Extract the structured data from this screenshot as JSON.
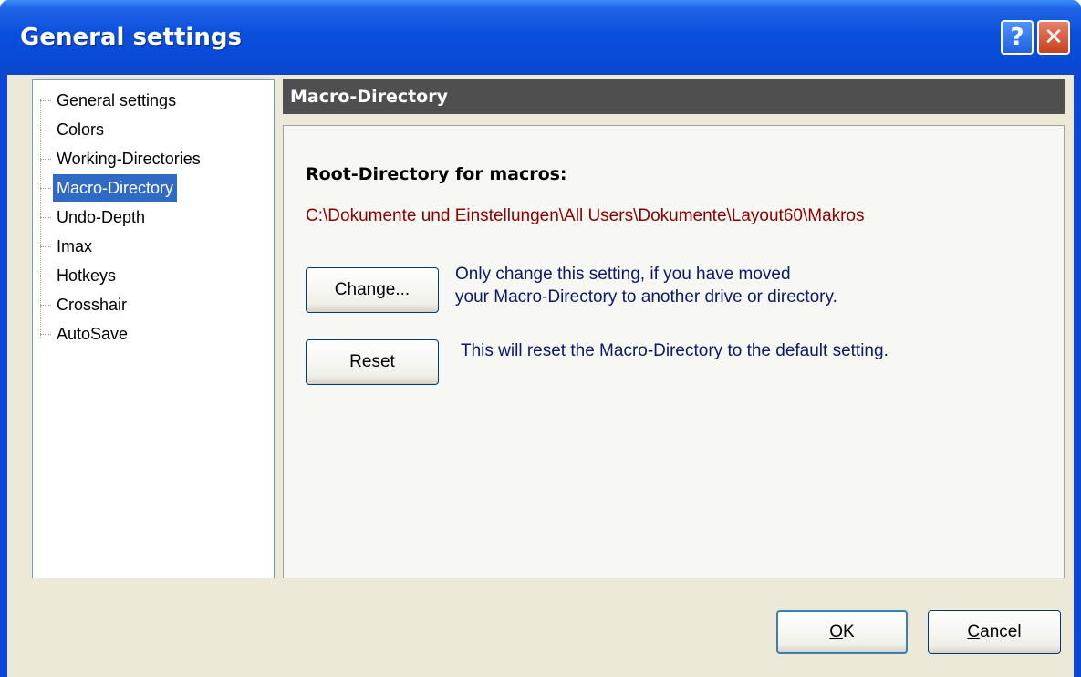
{
  "window": {
    "title": "General settings",
    "help_label": "?",
    "close_label": "✕"
  },
  "tree": {
    "items": [
      {
        "label": "General settings"
      },
      {
        "label": "Colors"
      },
      {
        "label": "Working-Directories"
      },
      {
        "label": "Macro-Directory",
        "selected": true
      },
      {
        "label": "Undo-Depth"
      },
      {
        "label": "Imax"
      },
      {
        "label": "Hotkeys"
      },
      {
        "label": "Crosshair"
      },
      {
        "label": "AutoSave"
      }
    ]
  },
  "section": {
    "header": "Macro-Directory",
    "root_label": "Root-Directory for macros:",
    "root_path": "C:\\Dokumente und Einstellungen\\All Users\\Dokumente\\Layout60\\Makros",
    "change_button": "Change...",
    "change_note_line1": "Only change this setting, if you have moved",
    "change_note_line2": "your Macro-Directory to another drive or directory.",
    "reset_button": "Reset",
    "reset_note": "This will reset the Macro-Directory to the default setting."
  },
  "footer": {
    "ok_accel": "O",
    "ok_rest": "K",
    "cancel_accel": "C",
    "cancel_rest": "ancel"
  },
  "colors": {
    "titlebar": "#0a4fdc",
    "selection": "#316ac5",
    "path_text": "#8b0000",
    "note_text": "#0b1a66",
    "header_bg": "#4f4f4f"
  }
}
